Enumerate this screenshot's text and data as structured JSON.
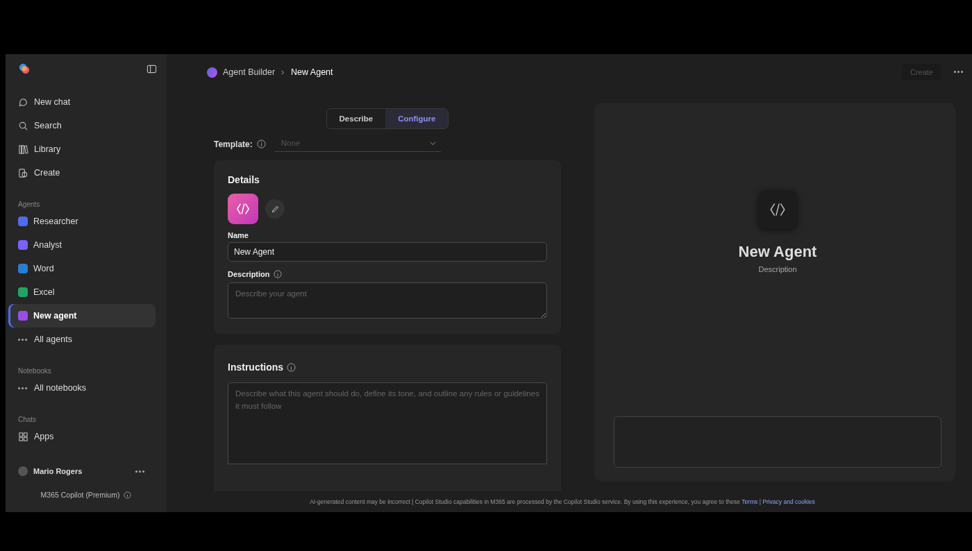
{
  "sidebar": {
    "items": [
      {
        "kind": "nav",
        "label": "New chat",
        "selected": false
      },
      {
        "kind": "nav",
        "label": "Search",
        "selected": false
      },
      {
        "kind": "nav",
        "label": "Library",
        "selected": false
      },
      {
        "kind": "nav",
        "label": "Create",
        "selected": false
      },
      {
        "kind": "heading",
        "label": "Agents"
      },
      {
        "kind": "agent",
        "label": "Researcher",
        "color": "#4f6bed",
        "selected": false
      },
      {
        "kind": "agent",
        "label": "Analyst",
        "color": "#7b61ff",
        "selected": false
      },
      {
        "kind": "agent",
        "label": "Word",
        "color": "#2b7cd3",
        "selected": false
      },
      {
        "kind": "agent",
        "label": "Excel",
        "color": "#21a366",
        "selected": false
      },
      {
        "kind": "agent",
        "label": "New agent",
        "color": "#9b4dea",
        "selected": true
      },
      {
        "kind": "more",
        "label": "All agents",
        "selected": false
      },
      {
        "kind": "heading",
        "label": "Notebooks"
      },
      {
        "kind": "more",
        "label": "All notebooks",
        "selected": false
      },
      {
        "kind": "heading",
        "label": "Chats"
      },
      {
        "kind": "nav",
        "label": "Apps",
        "selected": false
      }
    ],
    "user": {
      "name": "Mario Rogers",
      "plan": "M365 Copilot (Premium)"
    }
  },
  "breadcrumb": [
    "Agent Builder",
    "New Agent"
  ],
  "actions": {
    "create": "Create",
    "create_disabled": true
  },
  "tabs": [
    {
      "label": "Describe",
      "selected": false
    },
    {
      "label": "Configure",
      "selected": true
    }
  ],
  "template": {
    "label": "Template:",
    "placeholder": "None"
  },
  "details": {
    "title": "Details",
    "name_label": "Name",
    "name_value": "New Agent",
    "description_label": "Description",
    "description_placeholder": "Describe your agent"
  },
  "instructions": {
    "title": "Instructions",
    "placeholder": "Describe what this agent should do, define its tone, and outline any rules or guidelines it must follow"
  },
  "preview": {
    "title": "New Agent",
    "subtitle": "Description"
  },
  "footer": {
    "text": "AI-generated content may be incorrect | Copilot Studio capabilities in M365 are processed by the Copilot Studio service. By using this experience, you agree to these",
    "links": [
      "Terms",
      "Privacy and cookies"
    ],
    "separator": "|"
  }
}
